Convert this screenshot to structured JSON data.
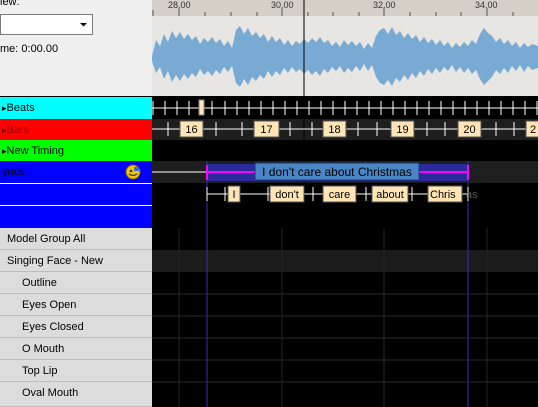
{
  "header": {
    "view_label": "iew:",
    "time_label": "me: 0:00.00"
  },
  "ruler": {
    "ticks": [
      "28.00",
      "30.00",
      "32.00",
      "34.00"
    ]
  },
  "rows": {
    "beats": "Beats",
    "bars": "Bars",
    "new_timing": "New Timing",
    "lyrics": "yrics"
  },
  "models": {
    "model_group": "Model Group All",
    "singing_face": "Singing Face - New",
    "outline": "Outline",
    "eyes_open": "Eyes Open",
    "eyes_closed": "Eyes Closed",
    "o_mouth": "O Mouth",
    "top_lip": "Top Lip",
    "oval_mouth": "Oval Mouth"
  },
  "bars": {
    "labels": [
      "16",
      "17",
      "18",
      "19",
      "20",
      "2"
    ]
  },
  "lyrics": {
    "phrase": "I don't care about Christmas",
    "words": [
      "I",
      "don't",
      "care",
      "about",
      "Chris"
    ],
    "overflow": "as"
  },
  "colors": {
    "beats_row": "#00ffff",
    "bars_row": "#ff0000",
    "timing_row": "#00ff00",
    "lyrics_row": "#0000ff",
    "phrase_fill": "#4a86c5",
    "word_fill": "#ffe4b5",
    "wave": "#79aad4"
  }
}
